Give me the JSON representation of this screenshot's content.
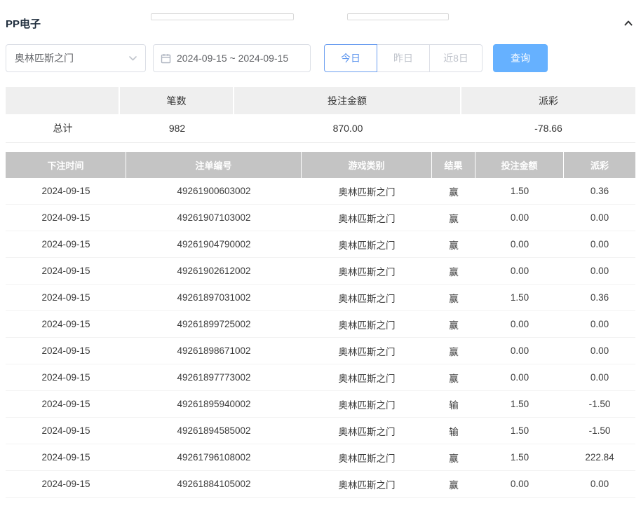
{
  "header": {
    "title": "PP电子"
  },
  "filters": {
    "game_select_value": "奥林匹斯之门",
    "date_range": "2024-09-15 ~ 2024-09-15",
    "quick_buttons": [
      {
        "label": "今日",
        "active": true
      },
      {
        "label": "昨日",
        "active": false
      },
      {
        "label": "近8日",
        "active": false
      }
    ],
    "search_label": "查询"
  },
  "summary": {
    "headers": {
      "count": "笔数",
      "amount": "投注金额",
      "payout": "派彩"
    },
    "row_label": "总计",
    "count": "982",
    "amount": "870.00",
    "payout": "-78.66"
  },
  "table": {
    "headers": {
      "time": "下注时间",
      "id": "注单编号",
      "game": "游戏类别",
      "result": "结果",
      "amount": "投注金额",
      "payout": "派彩"
    },
    "rows": [
      {
        "time": "2024-09-15",
        "id": "49261900603002",
        "game": "奥林匹斯之门",
        "result": "赢",
        "amount": "1.50",
        "payout": "0.36"
      },
      {
        "time": "2024-09-15",
        "id": "49261907103002",
        "game": "奥林匹斯之门",
        "result": "赢",
        "amount": "0.00",
        "payout": "0.00"
      },
      {
        "time": "2024-09-15",
        "id": "49261904790002",
        "game": "奥林匹斯之门",
        "result": "赢",
        "amount": "0.00",
        "payout": "0.00"
      },
      {
        "time": "2024-09-15",
        "id": "49261902612002",
        "game": "奥林匹斯之门",
        "result": "赢",
        "amount": "0.00",
        "payout": "0.00"
      },
      {
        "time": "2024-09-15",
        "id": "49261897031002",
        "game": "奥林匹斯之门",
        "result": "赢",
        "amount": "1.50",
        "payout": "0.36"
      },
      {
        "time": "2024-09-15",
        "id": "49261899725002",
        "game": "奥林匹斯之门",
        "result": "赢",
        "amount": "0.00",
        "payout": "0.00"
      },
      {
        "time": "2024-09-15",
        "id": "49261898671002",
        "game": "奥林匹斯之门",
        "result": "赢",
        "amount": "0.00",
        "payout": "0.00"
      },
      {
        "time": "2024-09-15",
        "id": "49261897773002",
        "game": "奥林匹斯之门",
        "result": "赢",
        "amount": "0.00",
        "payout": "0.00"
      },
      {
        "time": "2024-09-15",
        "id": "49261895940002",
        "game": "奥林匹斯之门",
        "result": "输",
        "amount": "1.50",
        "payout": "-1.50"
      },
      {
        "time": "2024-09-15",
        "id": "49261894585002",
        "game": "奥林匹斯之门",
        "result": "输",
        "amount": "1.50",
        "payout": "-1.50"
      },
      {
        "time": "2024-09-15",
        "id": "49261796108002",
        "game": "奥林匹斯之门",
        "result": "赢",
        "amount": "1.50",
        "payout": "222.84"
      },
      {
        "time": "2024-09-15",
        "id": "49261884105002",
        "game": "奥林匹斯之门",
        "result": "赢",
        "amount": "0.00",
        "payout": "0.00"
      }
    ]
  },
  "colors": {
    "accent_blue": "#66b1ff",
    "active_border_blue": "#6d9ff0",
    "negative_red": "#f2606a",
    "table_header_gray": "#c4c4c4",
    "summary_header_gray": "#efefef"
  }
}
